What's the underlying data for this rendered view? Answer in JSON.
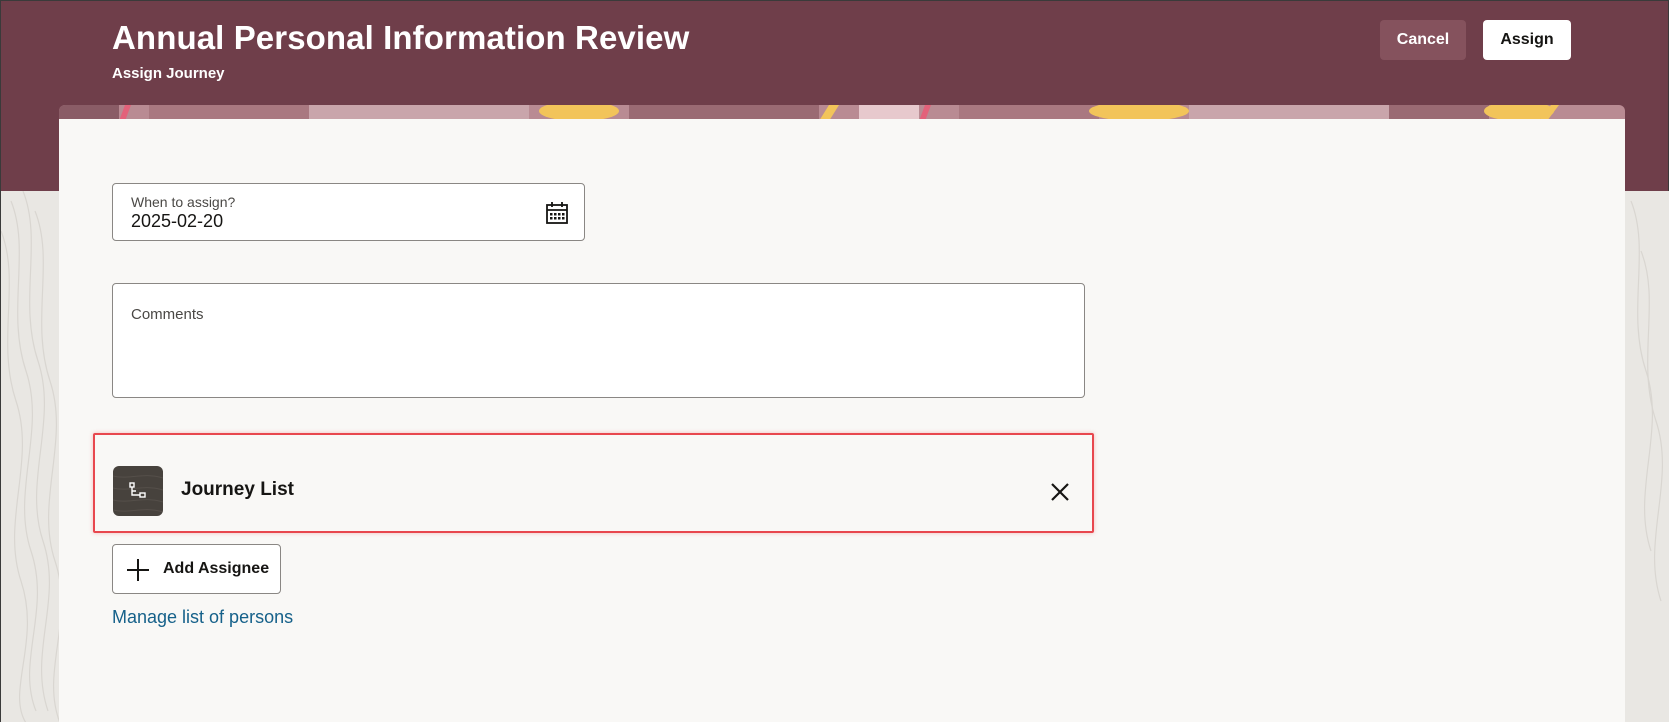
{
  "header": {
    "title": "Annual Personal Information Review",
    "subtitle": "Assign Journey",
    "cancel_label": "Cancel",
    "assign_label": "Assign",
    "background_color": "#6f3e4a"
  },
  "form": {
    "date_field": {
      "label": "When to assign?",
      "value": "2025-02-20",
      "icon": "calendar-icon"
    },
    "comments": {
      "label": "Comments",
      "value": ""
    },
    "journey_list": {
      "label": "Journey List",
      "avatar_icon": "hierarchy-icon",
      "remove_icon": "close-icon",
      "highlight_color": "#e8474e"
    },
    "add_assignee_label": "Add Assignee",
    "manage_link": "Manage list of persons"
  },
  "colors": {
    "link": "#16618a",
    "text": "#161513"
  }
}
